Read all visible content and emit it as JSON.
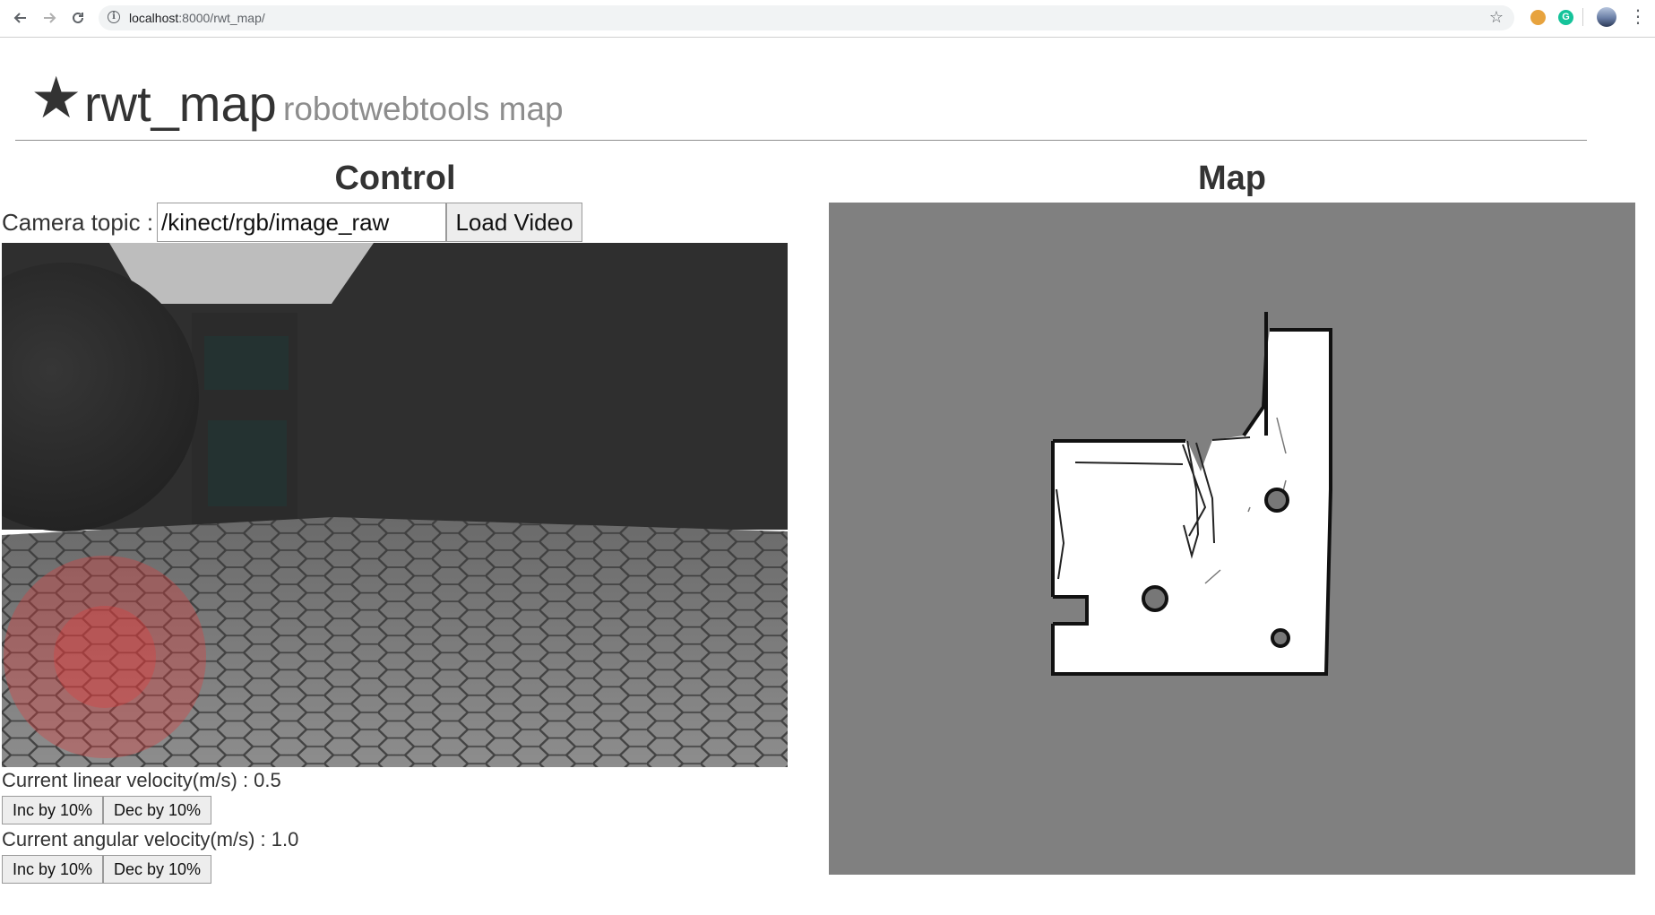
{
  "browser": {
    "url_host": "localhost",
    "url_path": ":8000/rwt_map/",
    "icons": {
      "back": "arrow-left-icon",
      "forward": "arrow-right-icon",
      "reload": "reload-icon",
      "info": "info-icon",
      "bookmark": "star-outline-icon",
      "menu": "kebab-menu-icon"
    }
  },
  "header": {
    "star": "★",
    "title": "rwt_map",
    "subtitle": "robotwebtools map"
  },
  "control": {
    "title": "Control",
    "camera_label": "Camera topic :",
    "camera_topic_value": "/kinect/rgb/image_raw",
    "load_button": "Load Video",
    "linear": {
      "label": "Current linear velocity(m/s) : 0.5",
      "inc": "Inc by 10%",
      "dec": "Dec by 10%"
    },
    "angular": {
      "label": "Current angular velocity(m/s) : 1.0",
      "inc": "Inc by 10%",
      "dec": "Dec by 10%"
    }
  },
  "map": {
    "title": "Map",
    "colors": {
      "unknown": "#808080",
      "free": "#ffffff",
      "occupied": "#000000"
    }
  },
  "colors": {
    "joystick": "#e23b3b"
  }
}
